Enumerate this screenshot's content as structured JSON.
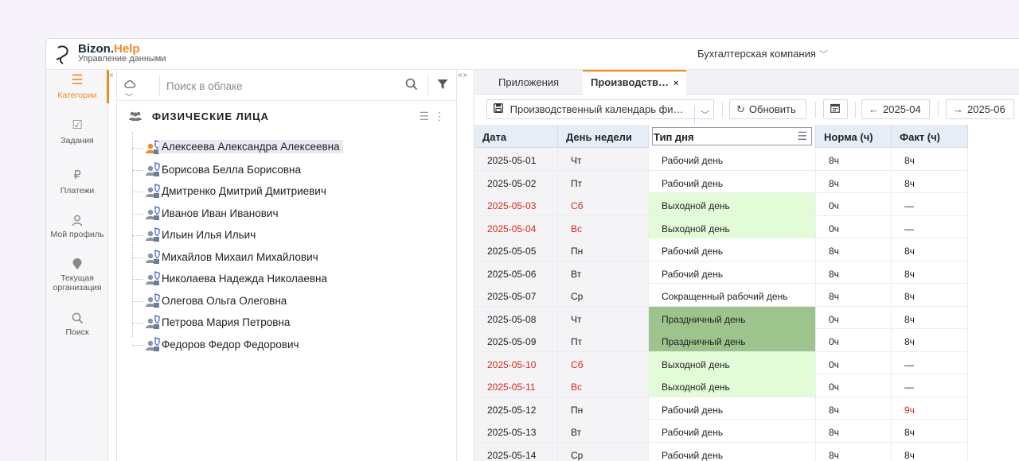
{
  "header": {
    "logo_name": "Bizon.",
    "logo_accent": "Help",
    "logo_sub": "Управление данными",
    "company": "Бухгалтерская компания"
  },
  "nav": {
    "items": [
      {
        "label": "Категории",
        "icon": "menu-icon"
      },
      {
        "label": "Задания",
        "icon": "checkbox-icon"
      },
      {
        "label": "Платежи",
        "icon": "ruble-icon"
      },
      {
        "label": "Мой профиль",
        "icon": "user-icon"
      },
      {
        "label": "Текущая организация",
        "icon": "location-pin-icon"
      },
      {
        "label": "Поиск",
        "icon": "search-icon"
      }
    ]
  },
  "tree": {
    "search_placeholder": "Поиск в облаке",
    "group_title": "ФИЗИЧЕСКИЕ ЛИЦА",
    "people": [
      "Алексеева Александра Алексеевна",
      "Борисова Белла Борисовна",
      "Дмитренко Дмитрий Дмитриевич",
      "Иванов Иван Иванович",
      "Ильин Илья Ильич",
      "Михайлов Михаил Михайлович",
      "Николаева Надежда Николаевна",
      "Олегова Ольга Олеговна",
      "Петрова Мария Петровна",
      "Федоров Федор Федорович"
    ]
  },
  "tabs": [
    {
      "label": "Приложения"
    },
    {
      "label": "Производств…",
      "close": "×"
    }
  ],
  "toolbar": {
    "calendar_select": "Производственный календарь фи…",
    "refresh": "Обновить",
    "prev": "2025-04",
    "next": "2025-06"
  },
  "grid": {
    "columns": [
      "Дата",
      "День недели",
      "Тип дня",
      "Норма (ч)",
      "Факт (ч)"
    ],
    "rows": [
      {
        "date": "2025-05-01",
        "dow": "Чт",
        "type": "Рабочий день",
        "norm": "8ч",
        "fact": "8ч",
        "kind": "work"
      },
      {
        "date": "2025-05-02",
        "dow": "Пт",
        "type": "Рабочий день",
        "norm": "8ч",
        "fact": "8ч",
        "kind": "work"
      },
      {
        "date": "2025-05-03",
        "dow": "Сб",
        "type": "Выходной день",
        "norm": "0ч",
        "fact": "—",
        "kind": "weekend"
      },
      {
        "date": "2025-05-04",
        "dow": "Вс",
        "type": "Выходной день",
        "norm": "0ч",
        "fact": "—",
        "kind": "weekend"
      },
      {
        "date": "2025-05-05",
        "dow": "Пн",
        "type": "Рабочий день",
        "norm": "8ч",
        "fact": "8ч",
        "kind": "work"
      },
      {
        "date": "2025-05-06",
        "dow": "Вт",
        "type": "Рабочий день",
        "norm": "8ч",
        "fact": "8ч",
        "kind": "work"
      },
      {
        "date": "2025-05-07",
        "dow": "Ср",
        "type": "Сокращенный рабочий день",
        "norm": "8ч",
        "fact": "8ч",
        "kind": "work"
      },
      {
        "date": "2025-05-08",
        "dow": "Чт",
        "type": "Праздничный день",
        "norm": "0ч",
        "fact": "8ч",
        "kind": "holiday"
      },
      {
        "date": "2025-05-09",
        "dow": "Пт",
        "type": "Праздничный день",
        "norm": "0ч",
        "fact": "8ч",
        "kind": "holiday"
      },
      {
        "date": "2025-05-10",
        "dow": "Сб",
        "type": "Выходной день",
        "norm": "0ч",
        "fact": "—",
        "kind": "weekend"
      },
      {
        "date": "2025-05-11",
        "dow": "Вс",
        "type": "Выходной день",
        "norm": "0ч",
        "fact": "—",
        "kind": "weekend"
      },
      {
        "date": "2025-05-12",
        "dow": "Пн",
        "type": "Рабочий день",
        "norm": "8ч",
        "fact": "9ч",
        "kind": "work",
        "fact_alert": true
      },
      {
        "date": "2025-05-13",
        "dow": "Вт",
        "type": "Рабочий день",
        "norm": "8ч",
        "fact": "8ч",
        "kind": "work"
      },
      {
        "date": "2025-05-14",
        "dow": "Ср",
        "type": "Рабочий день",
        "norm": "8ч",
        "fact": "8ч",
        "kind": "work"
      }
    ]
  },
  "colors": {
    "accent": "#f08a24",
    "weekend_bg": "#e3fcd8",
    "holiday_bg": "#9ec48e",
    "alert_text": "#d9281e"
  }
}
